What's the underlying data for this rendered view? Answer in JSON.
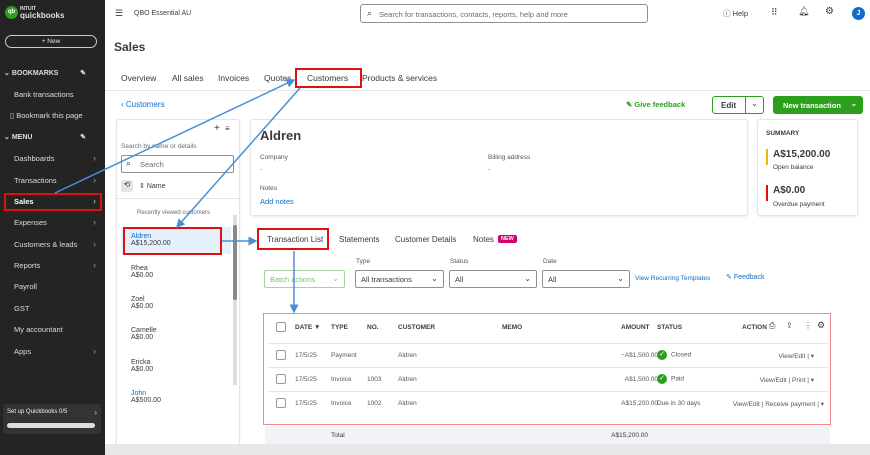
{
  "brand": {
    "top": "INTUIT",
    "name": "quickbooks"
  },
  "sidebar": {
    "new_label": "+ New",
    "bookmarks": "BOOKMARKS",
    "bank_transactions": "Bank transactions",
    "bookmark_page": "Bookmark this page",
    "menu": "MENU",
    "items": [
      {
        "label": "Dashboards"
      },
      {
        "label": "Transactions"
      },
      {
        "label": "Sales"
      },
      {
        "label": "Expenses"
      },
      {
        "label": "Customers & leads"
      },
      {
        "label": "Reports"
      },
      {
        "label": "Payroll"
      },
      {
        "label": "GST"
      },
      {
        "label": "My accountant"
      },
      {
        "label": "Apps"
      }
    ],
    "setup": "Set up Quickbooks 0/5",
    "setup_progress": 0
  },
  "topbar": {
    "company": "QBO Essential AU",
    "search_placeholder": "Search for transactions, contacts, reports, help and more",
    "help": "Help",
    "avatar": "J"
  },
  "page": {
    "title": "Sales",
    "tabs": [
      "Overview",
      "All sales",
      "Invoices",
      "Quotes",
      "Customers",
      "Products & services"
    ],
    "active_tab": "Customers",
    "back": "Customers",
    "feedback": "Give feedback",
    "edit": "Edit",
    "new_transaction": "New transaction"
  },
  "customer_list": {
    "search_label": "Search by name or details",
    "search_placeholder": "Search",
    "sort": "Name",
    "recent": "Recently viewed customers",
    "customers": [
      {
        "name": "Aldren",
        "balance": "A$15,200.00"
      },
      {
        "name": "Rhea",
        "balance": "A$0.00"
      },
      {
        "name": "Zoel",
        "balance": "A$0.00"
      },
      {
        "name": "Camelle",
        "balance": "A$0.00"
      },
      {
        "name": "Ericka",
        "balance": "A$0.00"
      },
      {
        "name": "John",
        "balance": "A$500.00"
      }
    ]
  },
  "customer": {
    "name": "Aldren",
    "company_label": "Company",
    "company": "-",
    "billing_label": "Billing address",
    "billing": "-",
    "notes_label": "Notes",
    "add_notes": "Add notes"
  },
  "summary": {
    "title": "SUMMARY",
    "open_balance": "A$15,200.00",
    "open_label": "Open balance",
    "overdue": "A$0.00",
    "overdue_label": "Overdue payment",
    "open_color": "#f2b705",
    "overdue_color": "#e01010"
  },
  "detail_tabs": [
    "Transaction List",
    "Statements",
    "Customer Details",
    "Notes"
  ],
  "new_badge": "NEW",
  "filters": {
    "batch": "Batch actions",
    "type_label": "Type",
    "type": "All transactions",
    "status_label": "Status",
    "status": "All",
    "date_label": "Date",
    "date": "All",
    "recurring": "View Recurring Templates",
    "feedback": "Feedback"
  },
  "table": {
    "headers": [
      "DATE ▼",
      "TYPE",
      "NO.",
      "CUSTOMER",
      "MEMO",
      "AMOUNT",
      "STATUS",
      "ACTION"
    ],
    "rows": [
      {
        "date": "17/5/25",
        "type": "Payment",
        "no": "",
        "customer": "Aldren",
        "amount": "−A$1,500.00",
        "status": "Closed",
        "actions": [
          "View/Edit"
        ]
      },
      {
        "date": "17/5/25",
        "type": "Invoice",
        "no": "1003",
        "customer": "Aldren",
        "amount": "A$1,500.00",
        "status": "Paid",
        "actions": [
          "View/Edit",
          "Print"
        ]
      },
      {
        "date": "17/5/25",
        "type": "Invoice",
        "no": "1002",
        "customer": "Aldren",
        "amount": "A$15,200.00",
        "status": "Due in 30 days",
        "actions": [
          "View/Edit",
          "Receive payment"
        ]
      }
    ],
    "total_label": "Total",
    "total": "A$15,200.00"
  }
}
